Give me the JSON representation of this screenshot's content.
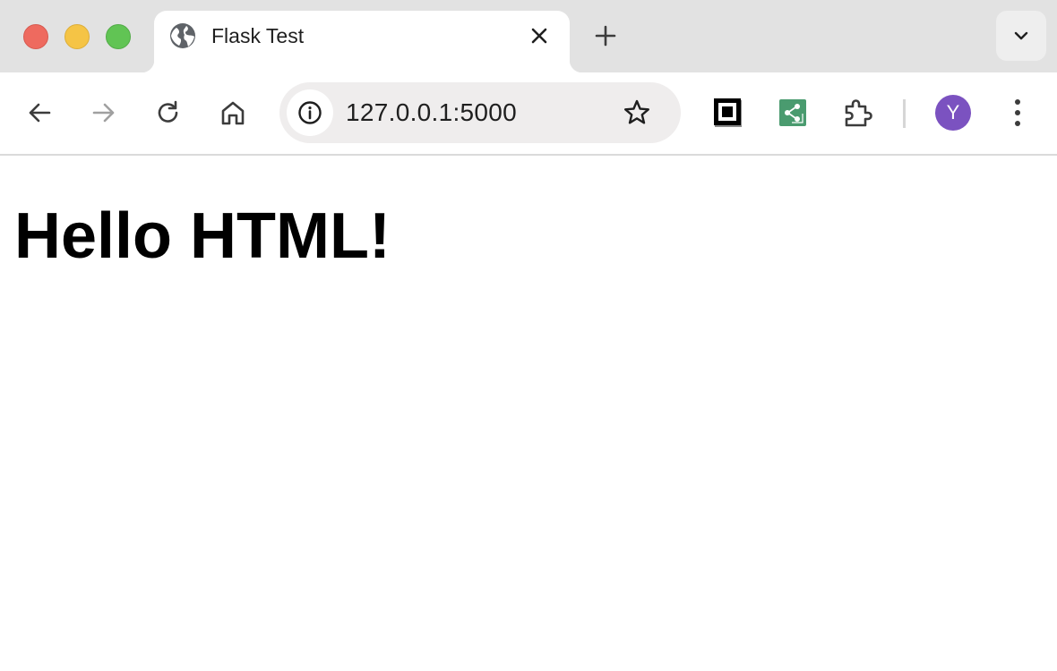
{
  "browser": {
    "tab": {
      "title": "Flask Test",
      "favicon": "globe-icon"
    },
    "toolbar": {
      "url": "127.0.0.1:5000",
      "profile_initial": "Y",
      "profile_color": "#7b52c0",
      "extensions": [
        "qr-code-extension-icon",
        "green-share-extension-icon",
        "puzzle-extensions-icon"
      ]
    }
  },
  "page": {
    "heading": "Hello HTML!"
  }
}
